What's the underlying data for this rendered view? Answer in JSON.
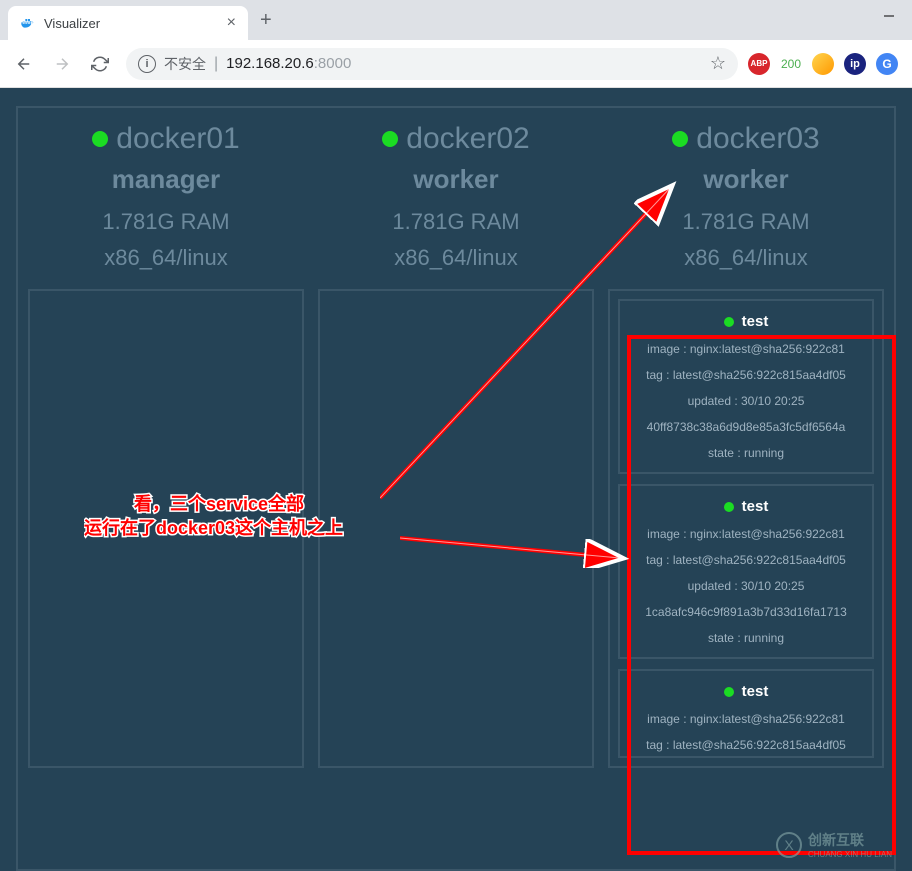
{
  "browser": {
    "tab_title": "Visualizer",
    "insecure_label": "不安全",
    "url_host": "192.168.20.6",
    "url_port": ":8000",
    "ext_abp": "ABP",
    "ext_count": "200",
    "ext_ip": "ip",
    "ext_g": "G"
  },
  "nodes": [
    {
      "name": "docker01",
      "role": "manager",
      "ram": "1.781G RAM",
      "arch": "x86_64/linux",
      "services": []
    },
    {
      "name": "docker02",
      "role": "worker",
      "ram": "1.781G RAM",
      "arch": "x86_64/linux",
      "services": []
    },
    {
      "name": "docker03",
      "role": "worker",
      "ram": "1.781G RAM",
      "arch": "x86_64/linux",
      "services": [
        {
          "name": "test",
          "image": "image : nginx:latest@sha256:922c81",
          "tag": "tag : latest@sha256:922c815aa4df05",
          "updated": "updated : 30/10 20:25",
          "id": "40ff8738c38a6d9d8e85a3fc5df6564a",
          "state": "state : running"
        },
        {
          "name": "test",
          "image": "image : nginx:latest@sha256:922c81",
          "tag": "tag : latest@sha256:922c815aa4df05",
          "updated": "updated : 30/10 20:25",
          "id": "1ca8afc946c9f891a3b7d33d16fa1713",
          "state": "state : running"
        },
        {
          "name": "test",
          "image": "image : nginx:latest@sha256:922c81",
          "tag": "tag : latest@sha256:922c815aa4df05",
          "updated": "",
          "id": "",
          "state": ""
        }
      ]
    }
  ],
  "annotation": {
    "line1": "看，三个service全部",
    "line2": "运行在了docker03这个主机之上"
  },
  "watermark": {
    "logo": "X",
    "text": "创新互联",
    "sub": "CHUANG XIN HU LIAN"
  }
}
